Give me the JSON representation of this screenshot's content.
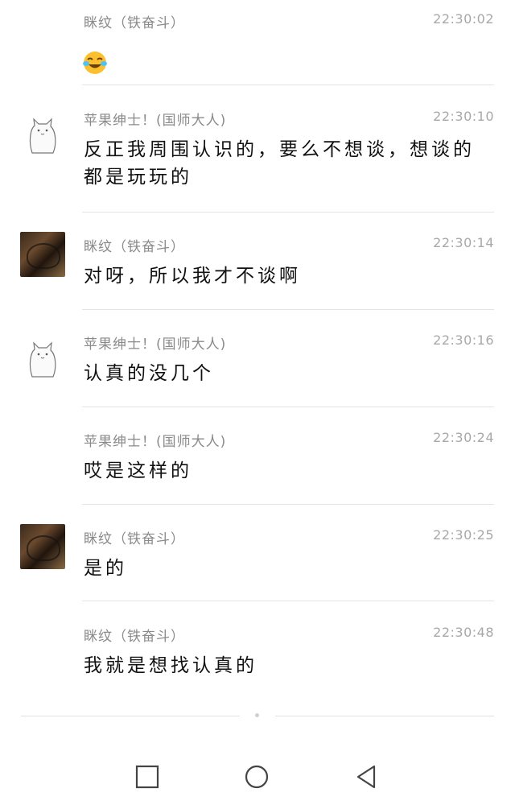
{
  "messages": [
    {
      "sender": "眯纹（铁奋斗）",
      "time": "22:30:02",
      "text": "",
      "emoji": "face-with-tears-of-joy",
      "avatar": "none"
    },
    {
      "sender": "苹果绅士！(国师大人)",
      "time": "22:30:10",
      "text": "反正我周围认识的，要么不想谈，想谈的都是玩玩的",
      "avatar": "cat"
    },
    {
      "sender": "眯纹（铁奋斗）",
      "time": "22:30:14",
      "text": "对呀，所以我才不谈啊",
      "avatar": "photo"
    },
    {
      "sender": "苹果绅士！(国师大人)",
      "time": "22:30:16",
      "text": "认真的没几个",
      "avatar": "cat"
    },
    {
      "sender": "苹果绅士！(国师大人)",
      "time": "22:30:24",
      "text": "哎是这样的",
      "avatar": "none"
    },
    {
      "sender": "眯纹（铁奋斗）",
      "time": "22:30:25",
      "text": "是的",
      "avatar": "photo"
    },
    {
      "sender": "眯纹（铁奋斗）",
      "time": "22:30:48",
      "text": "我就是想找认真的",
      "avatar": "none"
    }
  ],
  "navbar": {
    "icons": [
      "square-recents-icon",
      "circle-home-icon",
      "triangle-back-icon"
    ]
  }
}
